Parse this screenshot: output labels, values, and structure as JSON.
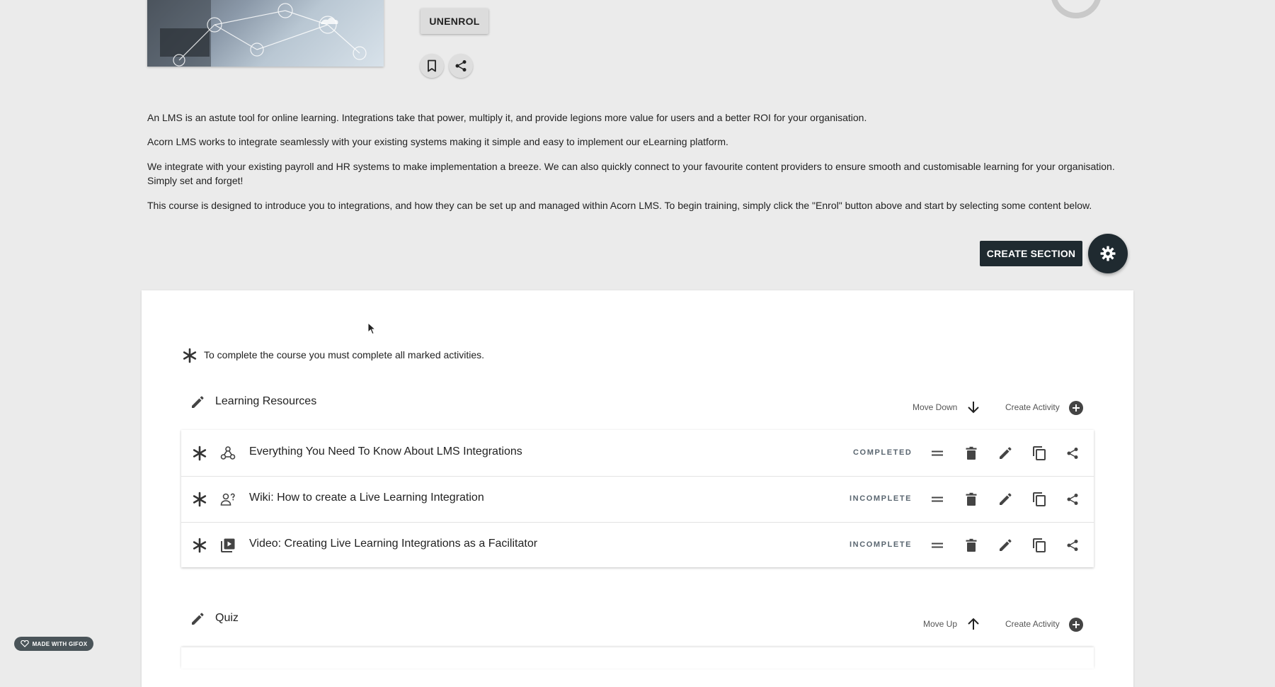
{
  "header": {
    "unenrol_label": "UNENROL",
    "bookmark_icon": "bookmark-icon",
    "share_icon": "share-icon"
  },
  "description": [
    "An LMS is an astute tool for online learning. Integrations take that power, multiply it, and provide legions more value for users and a better ROI for your organisation.",
    "Acorn LMS works to integrate seamlessly with your existing systems making it simple and easy to implement our eLearning platform.",
    "We integrate with your existing payroll and HR systems to make implementation a breeze. We can also quickly connect to your favourite content providers to ensure smooth and customisable learning for your organisation. Simply set and forget!",
    "This course is designed to introduce you to integrations, and how they can be set up and managed within Acorn LMS. To begin training, simply click the \"Enrol\" button above and start by selecting some content below."
  ],
  "toolbar": {
    "create_section_label": "CREATE SECTION",
    "settings_icon": "gear-icon"
  },
  "course": {
    "completion_note": "To complete the course you must complete all marked activities.",
    "sections": [
      {
        "title": "Learning Resources",
        "move_label": "Move Down",
        "create_activity_label": "Create Activity",
        "activities": [
          {
            "title": "Everything You Need To Know About LMS Integrations",
            "status": "COMPLETED",
            "type_icon": "webhook-icon"
          },
          {
            "title": "Wiki: How to create a Live Learning Integration",
            "status": "INCOMPLETE",
            "type_icon": "person-question-icon"
          },
          {
            "title": "Video: Creating Live Learning Integrations as a Facilitator",
            "status": "INCOMPLETE",
            "type_icon": "video-library-icon"
          }
        ]
      },
      {
        "title": "Quiz",
        "move_label": "Move Up",
        "create_activity_label": "Create Activity"
      }
    ]
  },
  "badge": {
    "label": "MADE WITH GIFOX"
  },
  "colors": {
    "dark": "#1f2a30",
    "background": "#ebebeb",
    "card": "#ffffff",
    "status": "#5a6670"
  }
}
